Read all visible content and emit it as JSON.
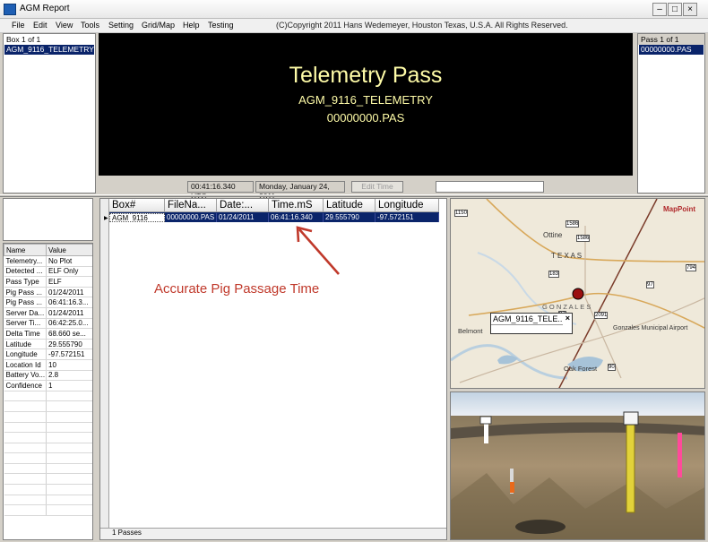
{
  "window": {
    "title": "AGM Report"
  },
  "menu": {
    "items": [
      "File",
      "Edit",
      "View",
      "Tools",
      "Setting",
      "Grid/Map",
      "Help",
      "Testing"
    ],
    "copyright": "(C)Copyright 2011 Hans Wedemeyer, Houston Texas, U.S.A. All Rights Reserved."
  },
  "box_pane": {
    "header": "Box 1 of 1",
    "selected": "AGM_9116_TELEMETRY"
  },
  "pass_pane": {
    "header": "Pass 1 of 1",
    "selected": "00000000.PAS"
  },
  "display": {
    "title": "Telemetry Pass",
    "line1": "AGM_9116_TELEMETRY",
    "line2": "00000000.PAS"
  },
  "status": {
    "time": "00:41:16.340 UTC",
    "date": "Monday, January 24, 2011",
    "edit_button": "Edit Time",
    "field_value": ""
  },
  "properties": {
    "col_name": "Name",
    "col_value": "Value",
    "rows": [
      {
        "name": "Telemetry...",
        "value": "No Plot"
      },
      {
        "name": "Detected ...",
        "value": "ELF Only"
      },
      {
        "name": "Pass Type",
        "value": "ELF"
      },
      {
        "name": "Pig Pass ...",
        "value": "01/24/2011"
      },
      {
        "name": "Pig Pass ...",
        "value": "06:41:16.3..."
      },
      {
        "name": "Server Da...",
        "value": "01/24/2011"
      },
      {
        "name": "Server Ti...",
        "value": "06:42:25.0..."
      },
      {
        "name": "Delta Time",
        "value": "68.660 se..."
      },
      {
        "name": "Latitude",
        "value": "29.555790"
      },
      {
        "name": "Longitude",
        "value": "-97.572151"
      },
      {
        "name": "Location Id",
        "value": "10"
      },
      {
        "name": "Battery Vo...",
        "value": "2.8"
      },
      {
        "name": "Confidence",
        "value": "1"
      }
    ]
  },
  "grid": {
    "columns": [
      "Box#",
      "FileNa...",
      "Date:...",
      "Time.mS",
      "Latitude",
      "Longitude"
    ],
    "row": [
      "AGM_9116_",
      "00000000.PAS",
      "01/24/2011",
      "06:41:16.340",
      "29.555790",
      "-97.572151"
    ],
    "footer": "1 Passes"
  },
  "annotation": {
    "text": "Accurate Pig Passage Time",
    "color": "#c0392b"
  },
  "map": {
    "brand": "MapPoint",
    "labels": {
      "ottine": "Ottine",
      "texas": "T E X A S",
      "gonzales": "G O N Z A L E S",
      "belmont": "Belmont",
      "airport": "Gonzales Municipal Airport",
      "oak_forest": "Oak Forest"
    },
    "shields": [
      "1586",
      "1586",
      "183",
      "794",
      "97",
      "97",
      "2091",
      "90",
      "1150"
    ],
    "popup": "AGM_9116_TELE..."
  },
  "colors": {
    "accent": "#0a246a",
    "display_text": "#fffca8"
  }
}
